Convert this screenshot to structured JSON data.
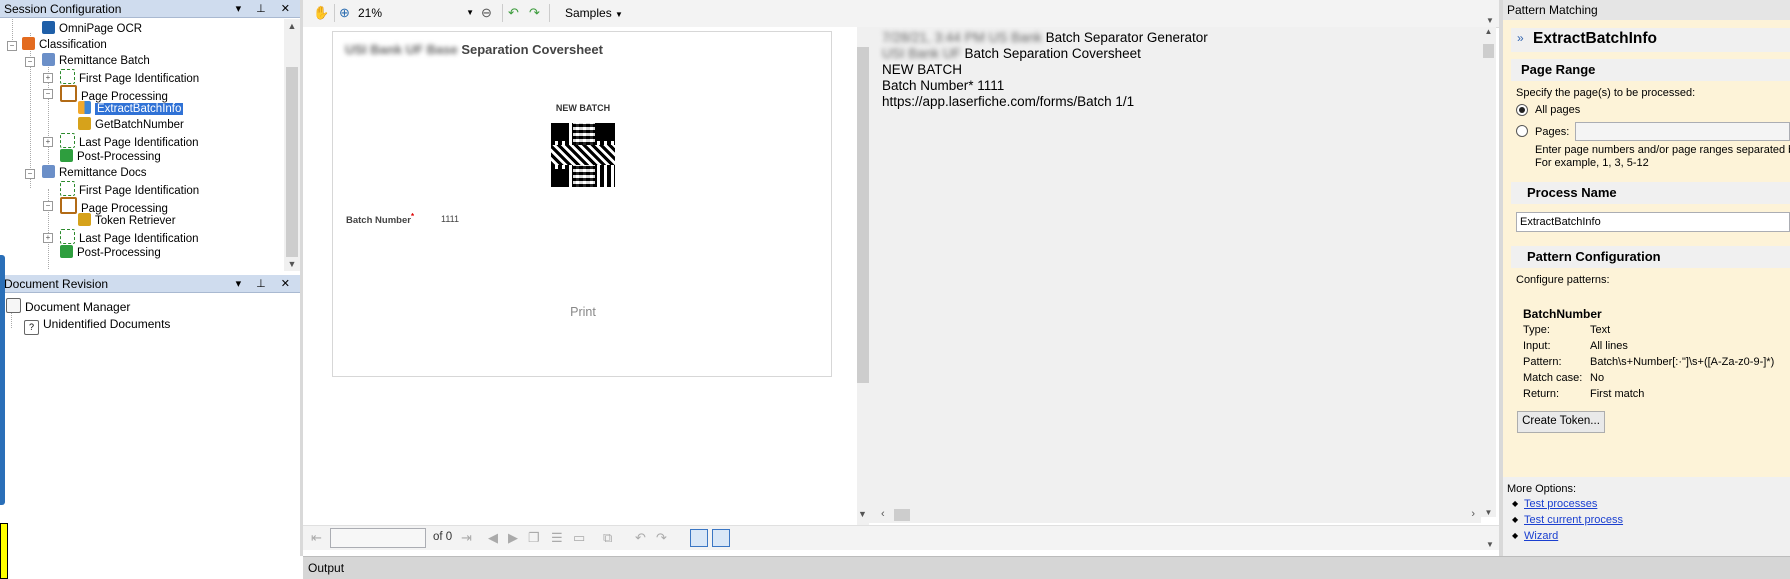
{
  "session_panel": {
    "title": "Session Configuration",
    "ctrls": "▾ ⊥ ✕",
    "tree": [
      {
        "label": "OmniPage OCR"
      },
      {
        "label": "Classification"
      },
      {
        "label": "Remittance Batch"
      },
      {
        "label": "First Page Identification"
      },
      {
        "label": "Page Processing"
      },
      {
        "label": "ExtractBatchInfo"
      },
      {
        "label": "GetBatchNumber"
      },
      {
        "label": "Last Page Identification"
      },
      {
        "label": "Post-Processing"
      },
      {
        "label": "Remittance Docs"
      },
      {
        "label": "First Page Identification"
      },
      {
        "label": "Page Processing"
      },
      {
        "label": "Token Retriever"
      },
      {
        "label": "Last Page Identification"
      },
      {
        "label": "Post-Processing"
      }
    ]
  },
  "revision_panel": {
    "title": "Document Revision",
    "ctrls": "▾ ⊥ ✕",
    "items": [
      "Document Manager",
      "Unidentified Documents"
    ]
  },
  "toolbar": {
    "zoom": "21%",
    "samples": "Samples"
  },
  "coversheet": {
    "title_blur": "USI Bank UF Base",
    "title": "Separation Coversheet",
    "new_batch": "NEW BATCH",
    "batch_label": "Batch Number",
    "required": "*",
    "batch_value": "1111",
    "print": "Print"
  },
  "ocr_text": {
    "line1_blur": "7/28/21, 3:44 PM US Bank",
    "line1": "Batch Separator Generator",
    "line2_blur": "USI Bank UF",
    "line2": "Batch Separation Coversheet",
    "line3": "NEW BATCH",
    "line4": "Batch Number* 1111",
    "line5": "https://app.laserfiche.com/forms/Batch 1/1"
  },
  "pager": {
    "of": "of 0"
  },
  "output": {
    "label": "Output"
  },
  "pattern_panel": {
    "title": "Pattern Matching",
    "process_heading": "ExtractBatchInfo",
    "page_range": {
      "heading": "Page Range",
      "desc": "Specify the page(s) to be processed:",
      "all_pages": "All pages",
      "pages": "Pages:",
      "hint1": "Enter page numbers and/or page ranges separated by",
      "hint2": "For example, 1, 3, 5-12"
    },
    "process_name": {
      "heading": "Process Name",
      "value": "ExtractBatchInfo"
    },
    "pattern_config": {
      "heading": "Pattern Configuration",
      "desc": "Configure patterns:",
      "name": "BatchNumber",
      "rows": [
        {
          "k": "Type:",
          "v": "Text"
        },
        {
          "k": "Input:",
          "v": "All lines"
        },
        {
          "k": "Pattern:",
          "v": "Batch\\s+Number[:·\"]\\s+([A-Za-z0-9-]*)"
        },
        {
          "k": "Match case:",
          "v": "No"
        },
        {
          "k": "Return:",
          "v": "First match"
        }
      ],
      "create_token": "Create Token..."
    },
    "more_options": {
      "label": "More Options:",
      "links": [
        "Test processes",
        "Test current process",
        "Wizard"
      ]
    }
  }
}
